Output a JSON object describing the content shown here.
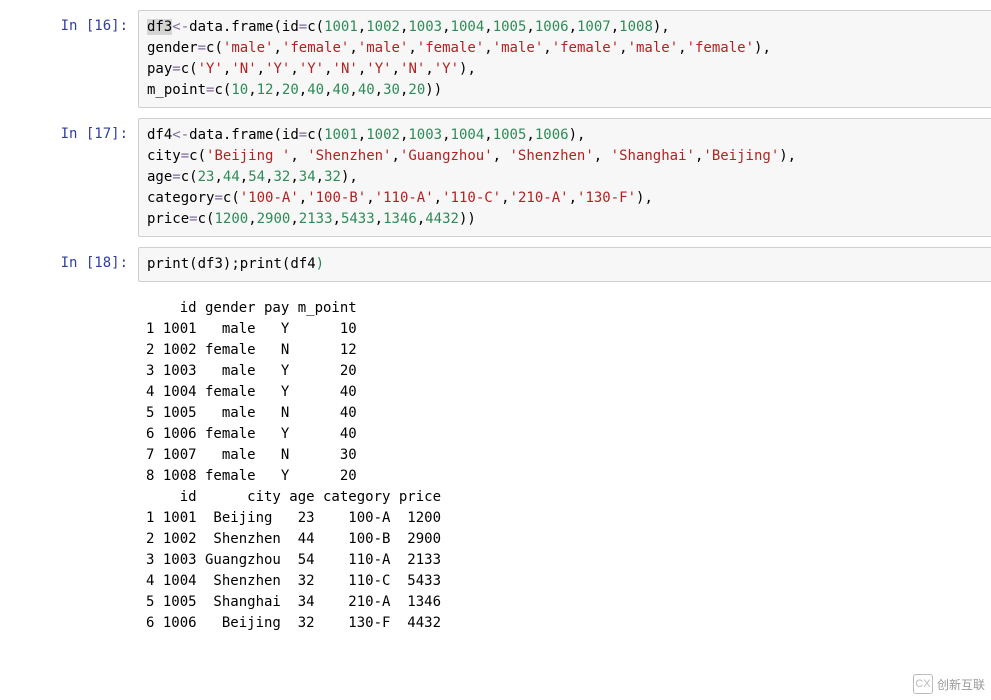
{
  "cells": [
    {
      "prompt": "In  [16]:",
      "tokens": [
        {
          "t": "df3",
          "c": "sel"
        },
        {
          "t": "<-",
          "c": "op"
        },
        {
          "t": "data.frame",
          "c": ""
        },
        {
          "t": "(",
          "c": ""
        },
        {
          "t": "id",
          "c": ""
        },
        {
          "t": "=",
          "c": "op"
        },
        {
          "t": "c",
          "c": ""
        },
        {
          "t": "(",
          "c": ""
        },
        {
          "t": "1001",
          "c": "num"
        },
        {
          "t": ",",
          "c": ""
        },
        {
          "t": "1002",
          "c": "num"
        },
        {
          "t": ",",
          "c": ""
        },
        {
          "t": "1003",
          "c": "num"
        },
        {
          "t": ",",
          "c": ""
        },
        {
          "t": "1004",
          "c": "num"
        },
        {
          "t": ",",
          "c": ""
        },
        {
          "t": "1005",
          "c": "num"
        },
        {
          "t": ",",
          "c": ""
        },
        {
          "t": "1006",
          "c": "num"
        },
        {
          "t": ",",
          "c": ""
        },
        {
          "t": "1007",
          "c": "num"
        },
        {
          "t": ",",
          "c": ""
        },
        {
          "t": "1008",
          "c": "num"
        },
        {
          "t": "),",
          "c": ""
        },
        {
          "t": "\n",
          "c": ""
        },
        {
          "t": "gender",
          "c": ""
        },
        {
          "t": "=",
          "c": "op"
        },
        {
          "t": "c",
          "c": ""
        },
        {
          "t": "(",
          "c": ""
        },
        {
          "t": "'male'",
          "c": "str"
        },
        {
          "t": ",",
          "c": ""
        },
        {
          "t": "'female'",
          "c": "str"
        },
        {
          "t": ",",
          "c": ""
        },
        {
          "t": "'male'",
          "c": "str"
        },
        {
          "t": ",",
          "c": ""
        },
        {
          "t": "'female'",
          "c": "str"
        },
        {
          "t": ",",
          "c": ""
        },
        {
          "t": "'male'",
          "c": "str"
        },
        {
          "t": ",",
          "c": ""
        },
        {
          "t": "'female'",
          "c": "str"
        },
        {
          "t": ",",
          "c": ""
        },
        {
          "t": "'male'",
          "c": "str"
        },
        {
          "t": ",",
          "c": ""
        },
        {
          "t": "'female'",
          "c": "str"
        },
        {
          "t": "),",
          "c": ""
        },
        {
          "t": "\n",
          "c": ""
        },
        {
          "t": "pay",
          "c": ""
        },
        {
          "t": "=",
          "c": "op"
        },
        {
          "t": "c",
          "c": ""
        },
        {
          "t": "(",
          "c": ""
        },
        {
          "t": "'Y'",
          "c": "str"
        },
        {
          "t": ",",
          "c": ""
        },
        {
          "t": "'N'",
          "c": "str"
        },
        {
          "t": ",",
          "c": ""
        },
        {
          "t": "'Y'",
          "c": "str"
        },
        {
          "t": ",",
          "c": ""
        },
        {
          "t": "'Y'",
          "c": "str"
        },
        {
          "t": ",",
          "c": ""
        },
        {
          "t": "'N'",
          "c": "str"
        },
        {
          "t": ",",
          "c": ""
        },
        {
          "t": "'Y'",
          "c": "str"
        },
        {
          "t": ",",
          "c": ""
        },
        {
          "t": "'N'",
          "c": "str"
        },
        {
          "t": ",",
          "c": ""
        },
        {
          "t": "'Y'",
          "c": "str"
        },
        {
          "t": "),",
          "c": ""
        },
        {
          "t": "\n",
          "c": ""
        },
        {
          "t": "m_point",
          "c": ""
        },
        {
          "t": "=",
          "c": "op"
        },
        {
          "t": "c",
          "c": ""
        },
        {
          "t": "(",
          "c": ""
        },
        {
          "t": "10",
          "c": "num"
        },
        {
          "t": ",",
          "c": ""
        },
        {
          "t": "12",
          "c": "num"
        },
        {
          "t": ",",
          "c": ""
        },
        {
          "t": "20",
          "c": "num"
        },
        {
          "t": ",",
          "c": ""
        },
        {
          "t": "40",
          "c": "num"
        },
        {
          "t": ",",
          "c": ""
        },
        {
          "t": "40",
          "c": "num"
        },
        {
          "t": ",",
          "c": ""
        },
        {
          "t": "40",
          "c": "num"
        },
        {
          "t": ",",
          "c": ""
        },
        {
          "t": "30",
          "c": "num"
        },
        {
          "t": ",",
          "c": ""
        },
        {
          "t": "20",
          "c": "num"
        },
        {
          "t": "))",
          "c": ""
        }
      ]
    },
    {
      "prompt": "In  [17]:",
      "tokens": [
        {
          "t": "df4",
          "c": ""
        },
        {
          "t": "<-",
          "c": "op"
        },
        {
          "t": "data.frame",
          "c": ""
        },
        {
          "t": "(",
          "c": ""
        },
        {
          "t": "id",
          "c": ""
        },
        {
          "t": "=",
          "c": "op"
        },
        {
          "t": "c",
          "c": ""
        },
        {
          "t": "(",
          "c": ""
        },
        {
          "t": "1001",
          "c": "num"
        },
        {
          "t": ",",
          "c": ""
        },
        {
          "t": "1002",
          "c": "num"
        },
        {
          "t": ",",
          "c": ""
        },
        {
          "t": "1003",
          "c": "num"
        },
        {
          "t": ",",
          "c": ""
        },
        {
          "t": "1004",
          "c": "num"
        },
        {
          "t": ",",
          "c": ""
        },
        {
          "t": "1005",
          "c": "num"
        },
        {
          "t": ",",
          "c": ""
        },
        {
          "t": "1006",
          "c": "num"
        },
        {
          "t": "),",
          "c": ""
        },
        {
          "t": "\n",
          "c": ""
        },
        {
          "t": "city",
          "c": ""
        },
        {
          "t": "=",
          "c": "op"
        },
        {
          "t": "c",
          "c": ""
        },
        {
          "t": "(",
          "c": ""
        },
        {
          "t": "'Beijing '",
          "c": "str"
        },
        {
          "t": ", ",
          "c": ""
        },
        {
          "t": "'Shenzhen'",
          "c": "str"
        },
        {
          "t": ",",
          "c": ""
        },
        {
          "t": "'Guangzhou'",
          "c": "str"
        },
        {
          "t": ", ",
          "c": ""
        },
        {
          "t": "'Shenzhen'",
          "c": "str"
        },
        {
          "t": ", ",
          "c": ""
        },
        {
          "t": "'Shanghai'",
          "c": "str"
        },
        {
          "t": ",",
          "c": ""
        },
        {
          "t": "'Beijing'",
          "c": "str"
        },
        {
          "t": "),",
          "c": ""
        },
        {
          "t": "\n",
          "c": ""
        },
        {
          "t": "age",
          "c": ""
        },
        {
          "t": "=",
          "c": "op"
        },
        {
          "t": "c",
          "c": ""
        },
        {
          "t": "(",
          "c": ""
        },
        {
          "t": "23",
          "c": "num"
        },
        {
          "t": ",",
          "c": ""
        },
        {
          "t": "44",
          "c": "num"
        },
        {
          "t": ",",
          "c": ""
        },
        {
          "t": "54",
          "c": "num"
        },
        {
          "t": ",",
          "c": ""
        },
        {
          "t": "32",
          "c": "num"
        },
        {
          "t": ",",
          "c": ""
        },
        {
          "t": "34",
          "c": "num"
        },
        {
          "t": ",",
          "c": ""
        },
        {
          "t": "32",
          "c": "num"
        },
        {
          "t": "),",
          "c": ""
        },
        {
          "t": "\n",
          "c": ""
        },
        {
          "t": "category",
          "c": ""
        },
        {
          "t": "=",
          "c": "op"
        },
        {
          "t": "c",
          "c": ""
        },
        {
          "t": "(",
          "c": ""
        },
        {
          "t": "'100-A'",
          "c": "str"
        },
        {
          "t": ",",
          "c": ""
        },
        {
          "t": "'100-B'",
          "c": "str"
        },
        {
          "t": ",",
          "c": ""
        },
        {
          "t": "'110-A'",
          "c": "str"
        },
        {
          "t": ",",
          "c": ""
        },
        {
          "t": "'110-C'",
          "c": "str"
        },
        {
          "t": ",",
          "c": ""
        },
        {
          "t": "'210-A'",
          "c": "str"
        },
        {
          "t": ",",
          "c": ""
        },
        {
          "t": "'130-F'",
          "c": "str"
        },
        {
          "t": "),",
          "c": ""
        },
        {
          "t": "\n",
          "c": ""
        },
        {
          "t": "price",
          "c": ""
        },
        {
          "t": "=",
          "c": "op"
        },
        {
          "t": "c",
          "c": ""
        },
        {
          "t": "(",
          "c": ""
        },
        {
          "t": "1200",
          "c": "num"
        },
        {
          "t": ",",
          "c": ""
        },
        {
          "t": "2900",
          "c": "num"
        },
        {
          "t": ",",
          "c": ""
        },
        {
          "t": "2133",
          "c": "num"
        },
        {
          "t": ",",
          "c": ""
        },
        {
          "t": "5433",
          "c": "num"
        },
        {
          "t": ",",
          "c": ""
        },
        {
          "t": "1346",
          "c": "num"
        },
        {
          "t": ",",
          "c": ""
        },
        {
          "t": "4432",
          "c": "num"
        },
        {
          "t": "))",
          "c": ""
        }
      ]
    },
    {
      "prompt": "In  [18]:",
      "tokens": [
        {
          "t": "print",
          "c": ""
        },
        {
          "t": "(",
          "c": ""
        },
        {
          "t": "df3",
          "c": ""
        },
        {
          "t": ")",
          "c": ""
        },
        {
          "t": ";",
          "c": ""
        },
        {
          "t": "print",
          "c": ""
        },
        {
          "t": "(",
          "c": ""
        },
        {
          "t": "df4",
          "c": ""
        },
        {
          "t": ")",
          "c": "num"
        }
      ],
      "output": "    id gender pay m_point\n1 1001   male   Y      10\n2 1002 female   N      12\n3 1003   male   Y      20\n4 1004 female   Y      40\n5 1005   male   N      40\n6 1006 female   Y      40\n7 1007   male   N      30\n8 1008 female   Y      20\n    id      city age category price\n1 1001  Beijing   23    100-A  1200\n2 1002  Shenzhen  44    100-B  2900\n3 1003 Guangzhou  54    110-A  2133\n4 1004  Shenzhen  32    110-C  5433\n5 1005  Shanghai  34    210-A  1346\n6 1006   Beijing  32    130-F  4432"
    }
  ],
  "watermark": "创新互联"
}
